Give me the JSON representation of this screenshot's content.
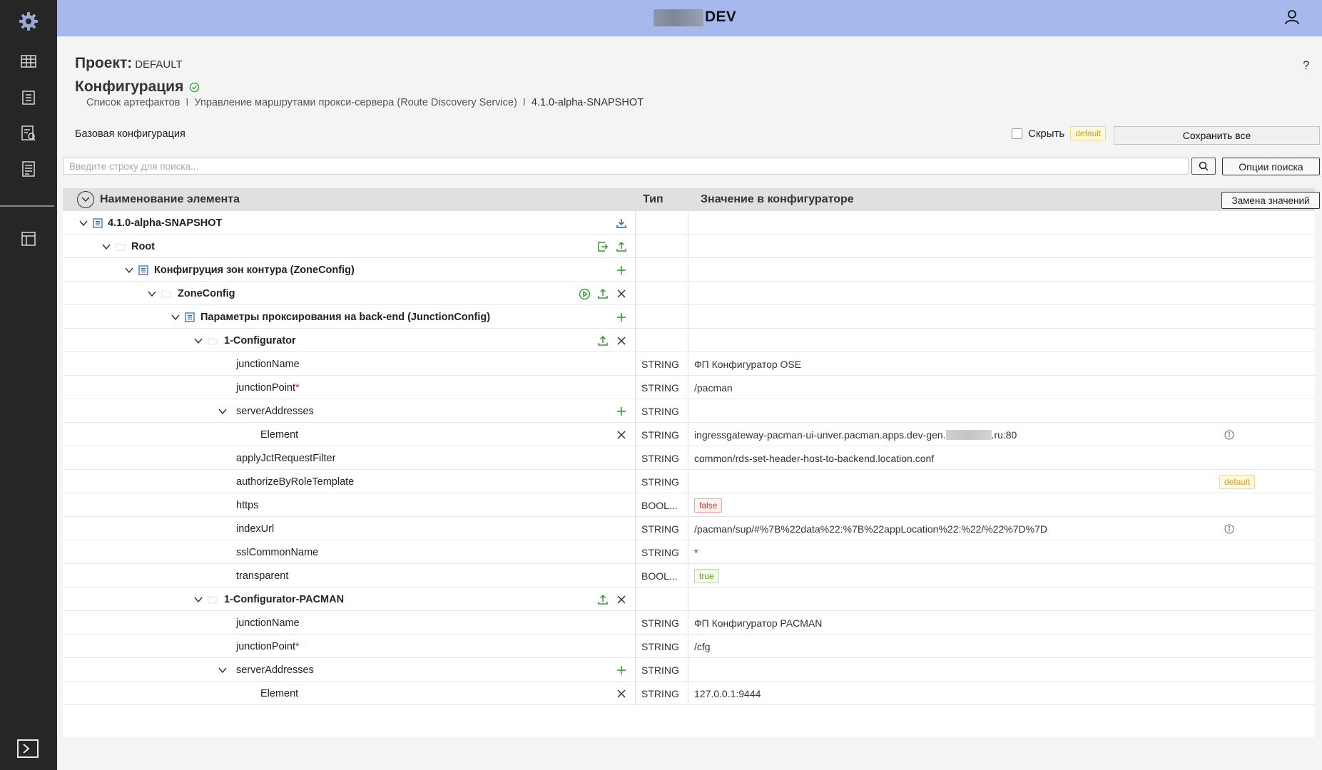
{
  "header": {
    "title": "DEV"
  },
  "sidebar": {
    "items": [
      "settings-icon",
      "table-icon",
      "list-icon",
      "report-icon",
      "document-icon",
      "layout-icon",
      "terminal-icon"
    ]
  },
  "page": {
    "project_label": "Проект:",
    "project_value": "DEFAULT",
    "help": "?",
    "config_title": "Конфигурация",
    "breadcrumb": {
      "b1": "Список артефактов",
      "sep": "I",
      "b2": "Управление маршрутами прокси-сервера (Route Discovery Service)",
      "b3": "4.1.0-alpha-SNAPSHOT"
    },
    "base_config": "Базовая конфигурация",
    "hide_label": "Скрыть",
    "default_tag": "default",
    "save_all": "Сохранить все"
  },
  "search": {
    "placeholder": "Введите строку для поиска...",
    "options_label": "Опции поиска"
  },
  "table": {
    "col_name": "Наименование элемента",
    "col_type": "Тип",
    "col_value": "Значение в конфигураторе",
    "replace_label": "Замена значений",
    "rows": [
      {
        "name": "4.1.0-alpha-SNAPSHOT",
        "type": "",
        "value": ""
      },
      {
        "name": "Root",
        "type": "",
        "value": ""
      },
      {
        "name": "Конфигруция зон контура (ZoneConfig)",
        "type": "",
        "value": ""
      },
      {
        "name": "ZoneConfig",
        "type": "",
        "value": ""
      },
      {
        "name": "Параметры проксирования на back-end (JunctionConfig)",
        "type": "",
        "value": ""
      },
      {
        "name": "1-Configurator",
        "type": "",
        "value": ""
      },
      {
        "name": "junctionName",
        "type": "STRING",
        "value": "ФП Конфигуратор OSE"
      },
      {
        "name": "junctionPoint",
        "req": "*",
        "type": "STRING",
        "value": "/pacman"
      },
      {
        "name": "serverAddresses",
        "type": "STRING",
        "value": ""
      },
      {
        "name": "Element",
        "type": "STRING",
        "value_a": "ingressgateway-pacman-ui-unver.pacman.apps.dev-gen.",
        "value_b": ".ru:80"
      },
      {
        "name": "applyJctRequestFilter",
        "type": "STRING",
        "value": "common/rds-set-header-host-to-backend.location.conf"
      },
      {
        "name": "authorizeByRoleTemplate",
        "type": "STRING",
        "value": "",
        "tag": "default"
      },
      {
        "name": "https",
        "type": "BOOL...",
        "value": "false"
      },
      {
        "name": "indexUrl",
        "type": "STRING",
        "value": "/pacman/sup/#%7B%22data%22:%7B%22appLocation%22:%22/%22%7D%7D"
      },
      {
        "name": "sslCommonName",
        "type": "STRING",
        "value": "*"
      },
      {
        "name": "transparent",
        "type": "BOOL...",
        "value": "true"
      },
      {
        "name": "1-Configurator-PACMAN",
        "type": "",
        "value": ""
      },
      {
        "name": "junctionName",
        "type": "STRING",
        "value": "ФП Конфигуратор PACMAN"
      },
      {
        "name": "junctionPoint",
        "req": "*",
        "type": "STRING",
        "value": "/cfg"
      },
      {
        "name": "serverAddresses",
        "type": "STRING",
        "value": ""
      },
      {
        "name": "Element",
        "type": "STRING",
        "value": "127.0.0.1:9444"
      }
    ]
  },
  "colors": {
    "header_bg": "#a6b8ec",
    "sidebar_bg": "#262626",
    "add_green": "#2e9e2e",
    "status_ok": "#3aa83a",
    "link_blue": "#2a5db0"
  }
}
